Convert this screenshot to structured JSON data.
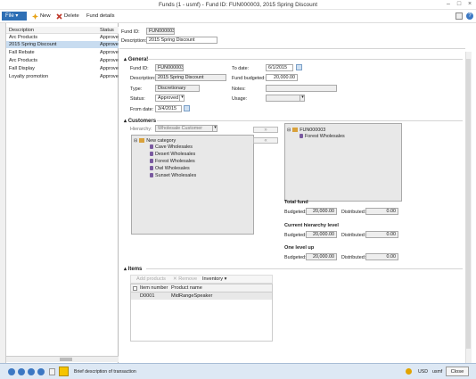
{
  "window": {
    "title": "Funds (1 - usmf) - Fund ID: FUN000003, 2015 Spring Discount"
  },
  "toolbar": {
    "file": "File",
    "new": "New",
    "delete": "Delete",
    "fund_details": "Fund details"
  },
  "list": {
    "columns": [
      "Description",
      "Status"
    ],
    "rows": [
      {
        "description": "Arc Products",
        "status": "Approve"
      },
      {
        "description": "2015 Spring Discount",
        "status": "Approve"
      },
      {
        "description": "Fall Rebate",
        "status": "Approve"
      },
      {
        "description": "Arc Products",
        "status": "Approve"
      },
      {
        "description": "Fall Display",
        "status": "Approve"
      },
      {
        "description": "Loyalty promotion",
        "status": "Approve"
      }
    ]
  },
  "header": {
    "fund_id_label": "Fund ID:",
    "fund_id": "FUN000003",
    "description_label": "Description:",
    "description": "2015 Spring Discount"
  },
  "general": {
    "title": "General",
    "fund_id_label": "Fund ID:",
    "fund_id": "FUN000003",
    "description_label": "Description:",
    "description": "2015 Spring Discount",
    "type_label": "Type:",
    "type": "Discretionary",
    "status_label": "Status:",
    "status": "Approved",
    "from_date_label": "From date:",
    "from_date": "3/4/2015",
    "to_date_label": "To date:",
    "to_date": "6/1/2015",
    "fund_budgeted_label": "Fund budgeted:",
    "fund_budgeted": "20,000.00",
    "notes_label": "Notes:",
    "notes": "",
    "usage_label": "Usage:",
    "usage": ""
  },
  "customers": {
    "title": "Customers",
    "hierarchy_label": "Hierarchy:",
    "hierarchy": "Wholesale Customer",
    "add_btn": "»",
    "remove_btn": "«",
    "tree": {
      "category": "New category",
      "children": [
        "Cave Wholesales",
        "Desert Wholesales",
        "Forest Wholesales",
        "Owl Wholesales",
        "Sunset Wholesales"
      ]
    },
    "selected_tree": {
      "root": "FUN000003",
      "children": [
        "Forest Wholesales"
      ]
    },
    "total_fund": {
      "title": "Total fund",
      "budgeted_label": "Budgeted:",
      "budgeted": "20,000.00",
      "distributed_label": "Distributed:",
      "distributed": "0.00"
    },
    "current_level": {
      "title": "Current hierarchy level",
      "budgeted_label": "Budgeted:",
      "budgeted": "20,000.00",
      "distributed_label": "Distributed:",
      "distributed": "0.00"
    },
    "one_level_up": {
      "title": "One level up",
      "budgeted_label": "Budgeted:",
      "budgeted": "20,000.00",
      "distributed_label": "Distributed:",
      "distributed": "0.00"
    }
  },
  "items": {
    "title": "Items",
    "add_products": "Add products",
    "remove": "Remove",
    "inventory": "Inventory",
    "columns": [
      "Item number",
      "Product name"
    ],
    "rows": [
      {
        "item_number": "D0001",
        "product_name": "MidRangeSpeaker"
      }
    ]
  },
  "status": {
    "text": "Brief description of transaction",
    "currency": "USD",
    "company": "usmf",
    "close": "Close"
  },
  "colors": {
    "accent": "#2e6fb5",
    "selected_row": "#c8dcf0",
    "statusbar": "#dde8f4"
  }
}
